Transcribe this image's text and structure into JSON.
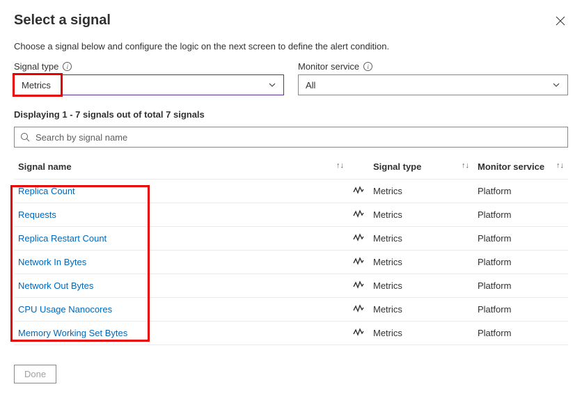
{
  "title": "Select a signal",
  "subtitle": "Choose a signal below and configure the logic on the next screen to define the alert condition.",
  "filters": {
    "signal_type": {
      "label": "Signal type",
      "value": "Metrics"
    },
    "monitor_service": {
      "label": "Monitor service",
      "value": "All"
    }
  },
  "status": "Displaying 1 - 7 signals out of total 7 signals",
  "search_placeholder": "Search by signal name",
  "columns": {
    "name": "Signal name",
    "type": "Signal type",
    "service": "Monitor service"
  },
  "signals": [
    {
      "name": "Replica Count",
      "type": "Metrics",
      "service": "Platform"
    },
    {
      "name": "Requests",
      "type": "Metrics",
      "service": "Platform"
    },
    {
      "name": "Replica Restart Count",
      "type": "Metrics",
      "service": "Platform"
    },
    {
      "name": "Network In Bytes",
      "type": "Metrics",
      "service": "Platform"
    },
    {
      "name": "Network Out Bytes",
      "type": "Metrics",
      "service": "Platform"
    },
    {
      "name": "CPU Usage Nanocores",
      "type": "Metrics",
      "service": "Platform"
    },
    {
      "name": "Memory Working Set Bytes",
      "type": "Metrics",
      "service": "Platform"
    }
  ],
  "done_label": "Done"
}
